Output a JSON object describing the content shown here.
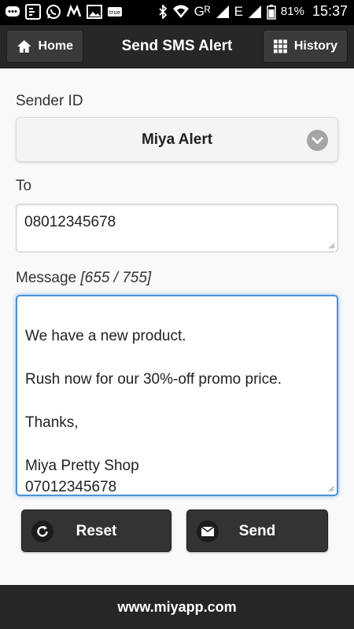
{
  "status_bar": {
    "battery_percent": "81%",
    "time": "15:37",
    "network": "Gᴿ",
    "network2": "E",
    "icons": [
      "messenger-icon",
      "bbm-icon",
      "whatsapp-icon",
      "mailru-icon",
      "gallery-icon",
      "truecaller-icon",
      "bluetooth-icon",
      "wifi-icon",
      "signal-icon",
      "battery-icon"
    ]
  },
  "header": {
    "home_label": "Home",
    "title": "Send SMS Alert",
    "history_label": "History"
  },
  "form": {
    "sender_label": "Sender ID",
    "sender_value": "Miya Alert",
    "to_label": "To",
    "to_value": "08012345678",
    "message_label": "Message",
    "message_count": "[655 / 755]",
    "message_value": "We have a new product.\n\nRush now for our 30%-off promo price.\n\nThanks,\n\nMiya Pretty Shop\n07012345678"
  },
  "actions": {
    "reset_label": "Reset",
    "send_label": "Send"
  },
  "footer": {
    "text": "www.miyapp.com"
  },
  "colors": {
    "header_bg": "#272727",
    "focus_border": "#4d90d6",
    "button_bg": "#333333"
  }
}
